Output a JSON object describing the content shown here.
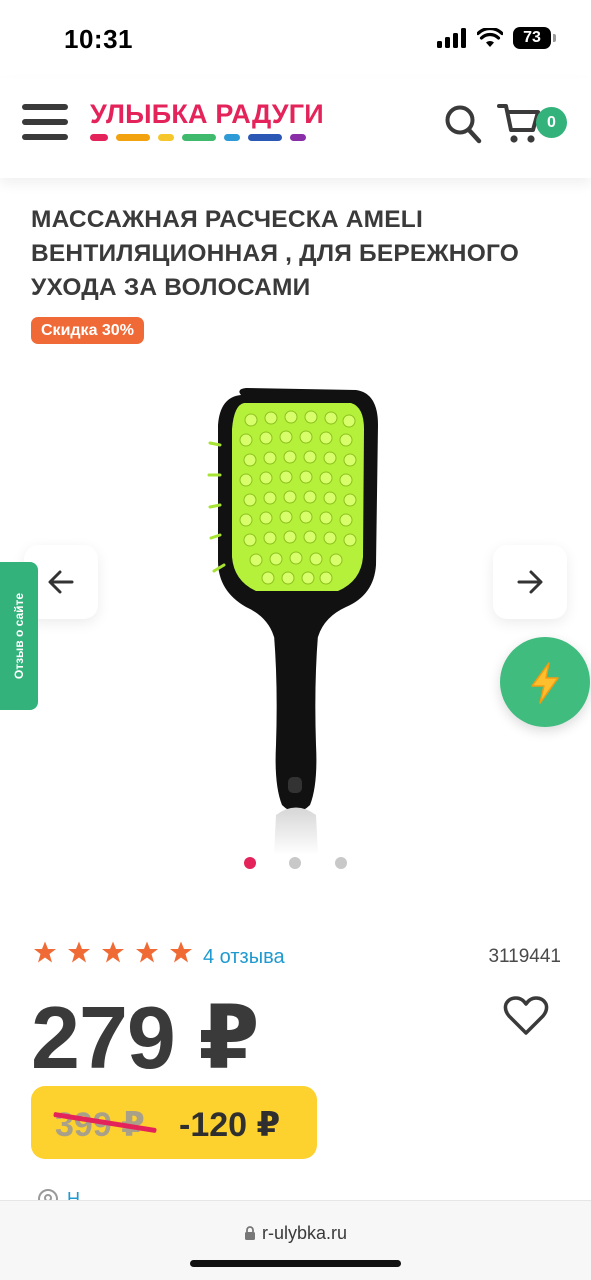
{
  "status": {
    "time": "10:31",
    "battery": "73"
  },
  "header": {
    "logo_text": "УЛЫБКА РАДУГИ",
    "logo_stripe_colors": [
      "#e4235a",
      "#f2a10f",
      "#f5c72c",
      "#3fba6c",
      "#2e9bd6",
      "#2b57b5",
      "#8a2ea8"
    ],
    "menu_icon": "hamburger-menu-icon",
    "search_icon": "search-icon",
    "cart_icon": "cart-icon",
    "cart_count": "0"
  },
  "product": {
    "title": "МАССАЖНАЯ РАСЧЕСКА AMELI ВЕНТИЛЯЦИОННАЯ , ДЛЯ БЕРЕЖНОГО УХОДА ЗА ВОЛОСАМИ",
    "discount_badge": "Скидка 30%",
    "image": "hair-brush-black-green-image",
    "rating_stars": 5,
    "reviews_label": "4 отзыва",
    "sku": "3119441",
    "price": "279 ₽",
    "old_price": "399 ₽",
    "saving": "-120 ₽"
  },
  "gallery": {
    "slide_count": 3,
    "active_slide": 1
  },
  "side": {
    "review_tab_label": "Отзыв о сайте"
  },
  "colors": {
    "accent_red": "#e4235a",
    "green": "#34b27b",
    "discount_orange": "#ef6a37",
    "price_yellow": "#fdd12e",
    "link_blue": "#1f9ad0",
    "star_orange": "#f06a35"
  },
  "browser": {
    "url": "r-ulybka.ru"
  },
  "partial": {
    "text": "Н"
  }
}
